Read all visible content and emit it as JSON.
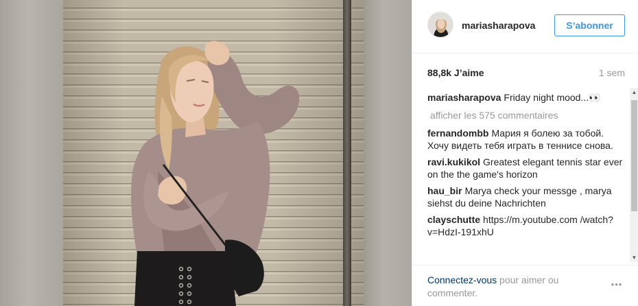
{
  "post": {
    "username": "mariasharapova",
    "follow_label": "S’abonner",
    "likes": "88,8k J’aime",
    "time": "1 sem"
  },
  "comments": {
    "caption": {
      "user": "mariasharapova",
      "text": "Friday night mood...👀"
    },
    "show_more": "afficher les 575 commentaires",
    "items": [
      {
        "user": "fernandombb",
        "text": "Мария я болею за тобой. Хочу видеть тебя играть в теннисе снова."
      },
      {
        "user": "ravi.kukikol",
        "text": "Greatest elegant tennis star ever on the the game's horizon"
      },
      {
        "user": "hau_bir",
        "text": "Marya check your messge , marya siehst du deine Nachrichten"
      },
      {
        "user": "clayschutte",
        "text": "https://m.youtube.com /watch?v=HdzI-191xhU"
      }
    ]
  },
  "footer": {
    "login_link": "Connectez-vous",
    "login_rest": " pour aimer ou commenter.",
    "more_icon": "•••"
  },
  "icons": {
    "scroll_up": "▲",
    "scroll_down": "▼"
  },
  "colors": {
    "accent": "#3897f0",
    "link_dark": "#003569",
    "muted": "#999999",
    "text": "#262626"
  }
}
